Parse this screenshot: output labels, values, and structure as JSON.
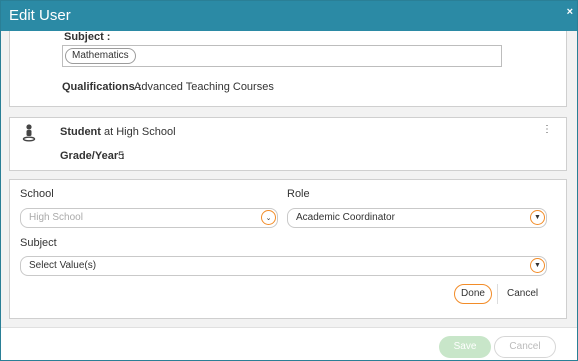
{
  "dialog": {
    "title": "Edit User",
    "close_symbol": "×"
  },
  "qualification_panel": {
    "subject_label": "Subject :",
    "subject_chip": "Mathematics",
    "qualifications_label": "Qualifications :",
    "qualifications_value": "Advanced Teaching Courses"
  },
  "student_panel": {
    "icon": "student-icon",
    "role": "Student",
    "at_text": "at High School",
    "grade_label": "Grade/Year :",
    "grade_value": "5",
    "menu_symbol": "⋮"
  },
  "edit_panel": {
    "school_label": "School",
    "school_value": "High School",
    "role_label": "Role",
    "role_value": "Academic Coordinator",
    "subject_label": "Subject",
    "subject_placeholder": "Select Value(s)",
    "done_label": "Done",
    "cancel_label": "Cancel"
  },
  "footer": {
    "save_label": "Save",
    "cancel_label": "Cancel"
  },
  "colors": {
    "titlebar": "#2b8aa5",
    "accent_ring": "#f28c28",
    "save_disabled": "#c8e6c9"
  }
}
